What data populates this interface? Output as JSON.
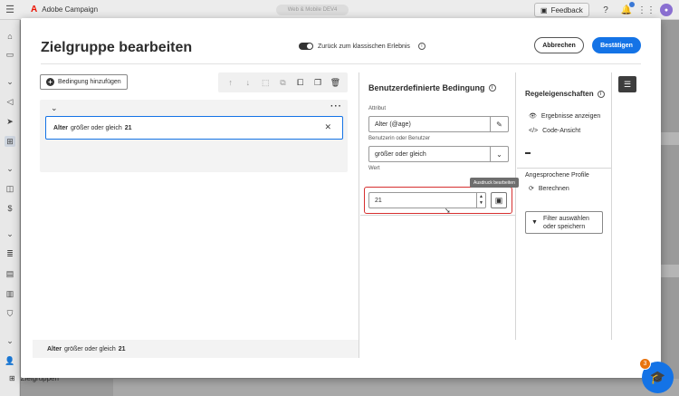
{
  "app": {
    "brand_name": "Adobe Campaign",
    "org_name": "Web & Mobile DEV4",
    "feedback_label": "Feedback",
    "bottom_nav_label": "Zielgruppen",
    "help_badge": "3"
  },
  "modal": {
    "title": "Zielgruppe bearbeiten",
    "toggle_label": "Zurück zum klassischen Erlebnis",
    "cancel_label": "Abbrechen",
    "confirm_label": "Bestätigen"
  },
  "rules": {
    "add_condition_label": "Bedingung hinzufügen",
    "toolbar_icons": [
      "arrow-up-icon",
      "arrow-down-icon",
      "select-icon",
      "ungroup-icon",
      "copy-icon",
      "paste-icon",
      "trash-icon"
    ],
    "condition": {
      "attribute": "Alter",
      "operator": "größer oder gleich",
      "value": "21"
    },
    "summary": {
      "attribute": "Alter",
      "operator": "größer oder gleich",
      "value": "21"
    }
  },
  "custom_condition": {
    "title": "Benutzerdefinierte Bedingung",
    "attribute_label": "Attribut",
    "attribute_value": "Alter (@age)",
    "operator_label": "Benutzerin oder Benutzer",
    "operator_value": "größer oder gleich",
    "value_label": "Wert",
    "value": "21",
    "tooltip": "Ausdruck bearbeiten"
  },
  "rule_properties": {
    "title": "Regeleigenschaften",
    "show_results_label": "Ergebnisse anzeigen",
    "code_view_label": "Code-Ansicht",
    "targeted_profiles_label": "Angesprochene Profile",
    "calculate_label": "Berechnen",
    "filter_label_line1": "Filter auswählen",
    "filter_label_line2": "oder speichern"
  },
  "colors": {
    "accent": "#1473e6",
    "highlight": "#d62f2f",
    "brand": "#eb1000",
    "badge": "#e8730e"
  }
}
